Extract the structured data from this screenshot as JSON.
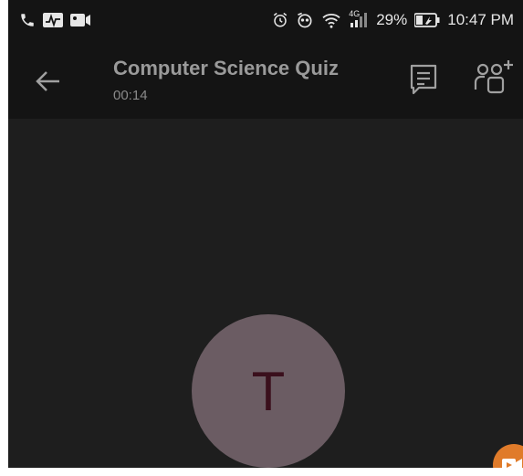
{
  "status_bar": {
    "battery_percent": "29%",
    "time": "10:47 PM",
    "network": "4G",
    "left_icons": [
      "phone-icon",
      "activity-icon",
      "video-icon"
    ],
    "right_icons": [
      "alarm-icon",
      "eye-icon",
      "wifi-icon",
      "signal-icon",
      "battery-icon"
    ]
  },
  "call_header": {
    "title": "Computer Science Quiz",
    "duration": "00:14"
  },
  "participant": {
    "initial": "T"
  },
  "colors": {
    "background": "#1e1e1e",
    "header": "#141414",
    "avatar": "#6b5c63",
    "avatar_text": "#3a0f1c",
    "fab": "#e07b2a"
  }
}
